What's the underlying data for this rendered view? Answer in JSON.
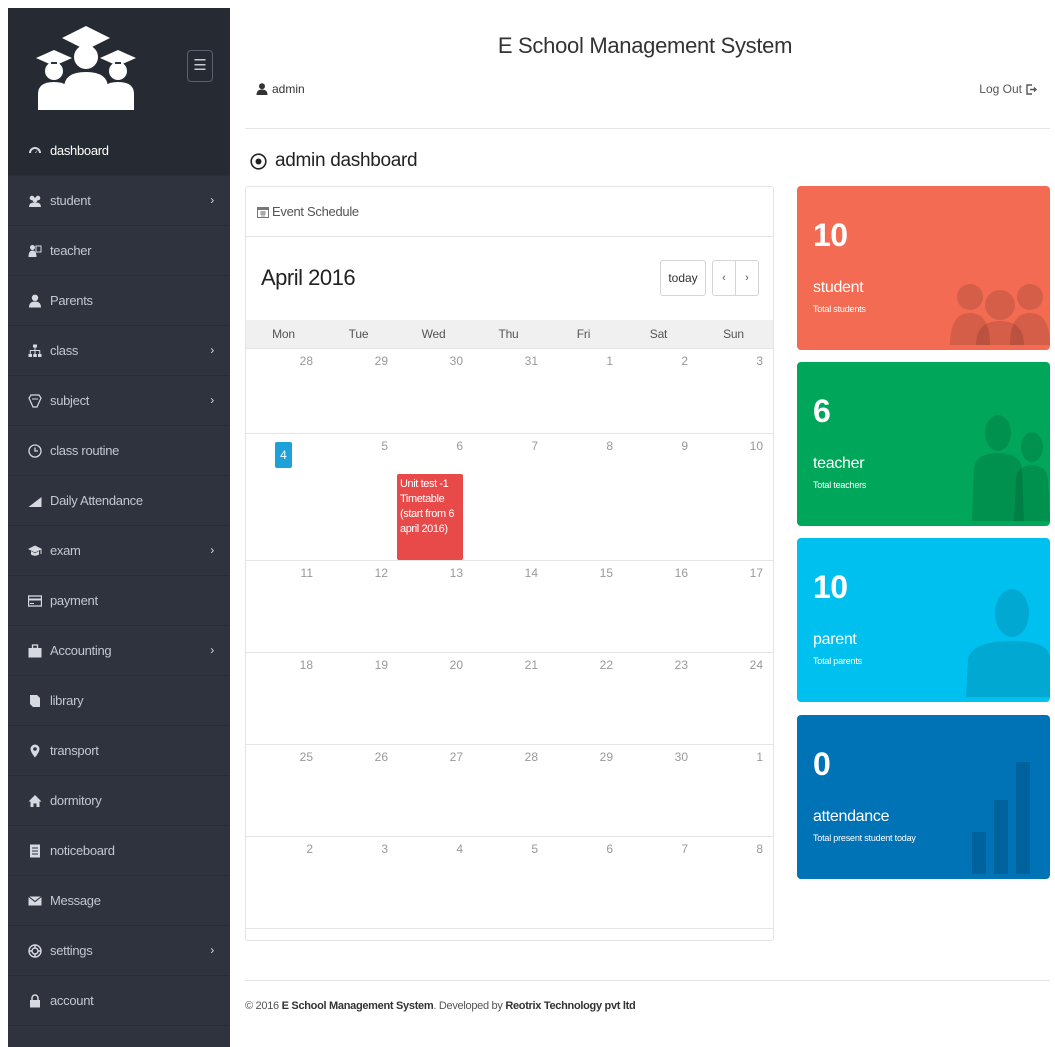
{
  "app": {
    "title": "E School Management System"
  },
  "header": {
    "user": "admin",
    "logout": "Log Out"
  },
  "page": {
    "title": "admin dashboard"
  },
  "sidebar": {
    "items": [
      {
        "label": "dashboard",
        "icon": "dashboard-icon",
        "active": true,
        "arrow": false
      },
      {
        "label": "student",
        "icon": "users-icon",
        "arrow": true
      },
      {
        "label": "teacher",
        "icon": "teacher-icon",
        "arrow": false
      },
      {
        "label": "Parents",
        "icon": "user-icon",
        "arrow": false
      },
      {
        "label": "class",
        "icon": "sitemap-icon",
        "arrow": true
      },
      {
        "label": "subject",
        "icon": "subject-icon",
        "arrow": true
      },
      {
        "label": "class routine",
        "icon": "clock-icon",
        "arrow": false
      },
      {
        "label": "Daily Attendance",
        "icon": "chart-icon",
        "arrow": false
      },
      {
        "label": "exam",
        "icon": "graduation-icon",
        "arrow": true
      },
      {
        "label": "payment",
        "icon": "credit-card-icon",
        "arrow": false
      },
      {
        "label": "Accounting",
        "icon": "briefcase-icon",
        "arrow": true
      },
      {
        "label": "library",
        "icon": "book-icon",
        "arrow": false
      },
      {
        "label": "transport",
        "icon": "map-marker-icon",
        "arrow": false
      },
      {
        "label": "dormitory",
        "icon": "home-icon",
        "arrow": false
      },
      {
        "label": "noticeboard",
        "icon": "list-icon",
        "arrow": false
      },
      {
        "label": "Message",
        "icon": "envelope-icon",
        "arrow": false
      },
      {
        "label": "settings",
        "icon": "settings-icon",
        "arrow": true
      },
      {
        "label": "account",
        "icon": "lock-icon",
        "arrow": false
      }
    ]
  },
  "calendar": {
    "panel_title": "Event Schedule",
    "month_title": "April 2016",
    "today_label": "today",
    "prev": "‹",
    "next": "›",
    "weekdays": [
      "Mon",
      "Tue",
      "Wed",
      "Thu",
      "Fri",
      "Sat",
      "Sun"
    ],
    "weeks": [
      [
        "28",
        "29",
        "30",
        "31",
        "1",
        "2",
        "3"
      ],
      [
        "4",
        "5",
        "6",
        "7",
        "8",
        "9",
        "10"
      ],
      [
        "11",
        "12",
        "13",
        "14",
        "15",
        "16",
        "17"
      ],
      [
        "18",
        "19",
        "20",
        "21",
        "22",
        "23",
        "24"
      ],
      [
        "25",
        "26",
        "27",
        "28",
        "29",
        "30",
        "1"
      ],
      [
        "2",
        "3",
        "4",
        "5",
        "6",
        "7",
        "8"
      ]
    ],
    "today_date": "4",
    "event": {
      "text": "Unit test -1 Timetable (start from 6 april 2016)",
      "color": "#e84a4a"
    }
  },
  "stats": [
    {
      "value": "10",
      "label": "student",
      "desc": "Total students",
      "color": "#f26b52"
    },
    {
      "value": "6",
      "label": "teacher",
      "desc": "Total teachers",
      "color": "#00a65a"
    },
    {
      "value": "10",
      "label": "parent",
      "desc": "Total parents",
      "color": "#00c0ef"
    },
    {
      "value": "0",
      "label": "attendance",
      "desc": "Total present student today",
      "color": "#0073b7"
    }
  ],
  "footer": {
    "prefix": "© 2016",
    "name": "E School Management System",
    "middle": ". Developed by",
    "company": "Reotrix Technology pvt ltd"
  }
}
